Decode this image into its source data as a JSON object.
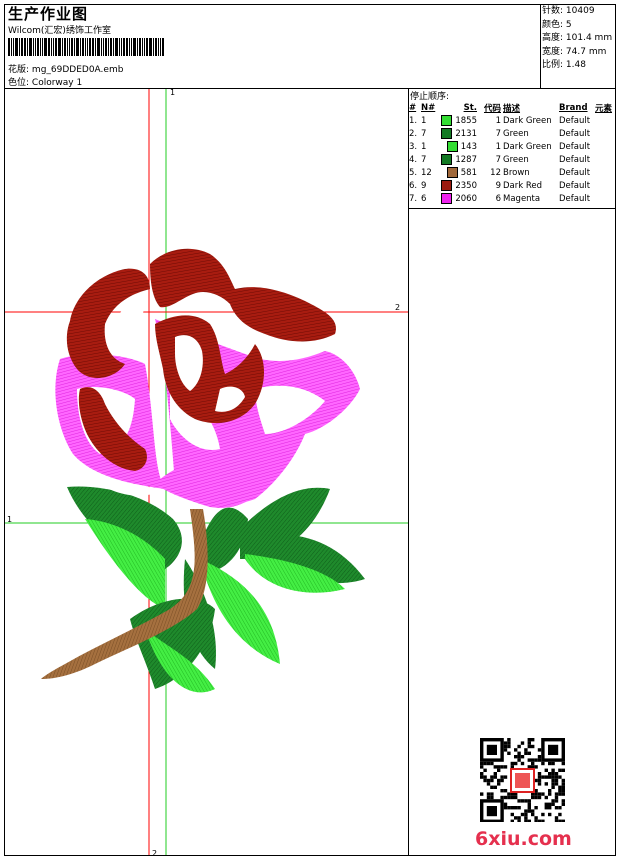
{
  "header": {
    "title": "生产作业图",
    "company": "Wilcom(汇宏)绣饰工作室",
    "design_label": "花版:",
    "design_file": "mg_69DDED0A.emb",
    "colorway_label": "色位:",
    "colorway": "Colorway 1"
  },
  "stats": [
    {
      "label": "针数:",
      "value": "10409"
    },
    {
      "label": "颜色:",
      "value": "5"
    },
    {
      "label": "高度:",
      "value": "101.4 mm"
    },
    {
      "label": "宽度:",
      "value": "74.7 mm"
    },
    {
      "label": "比例:",
      "value": "1.48"
    }
  ],
  "stop_sequence": {
    "label": "停止顺序:",
    "headers": [
      "#",
      "N#",
      "St.",
      "代码",
      "描述",
      "Brand",
      "元素"
    ],
    "rows": [
      {
        "idx": "1.",
        "n": "1",
        "color": "#33dd33",
        "st": "1855",
        "code": "1",
        "desc": "Dark Green",
        "brand": "Default"
      },
      {
        "idx": "2.",
        "n": "7",
        "color": "#137a24",
        "st": "2131",
        "code": "7",
        "desc": "Green",
        "brand": "Default"
      },
      {
        "idx": "3.",
        "n": "1",
        "color": "#33dd33",
        "st": "143",
        "code": "1",
        "desc": "Dark Green",
        "brand": "Default"
      },
      {
        "idx": "4.",
        "n": "7",
        "color": "#137a24",
        "st": "1287",
        "code": "7",
        "desc": "Green",
        "brand": "Default"
      },
      {
        "idx": "5.",
        "n": "12",
        "color": "#a0683a",
        "st": "581",
        "code": "12",
        "desc": "Brown",
        "brand": "Default"
      },
      {
        "idx": "6.",
        "n": "9",
        "color": "#9a1a10",
        "st": "2350",
        "code": "9",
        "desc": "Dark Red",
        "brand": "Default"
      },
      {
        "idx": "7.",
        "n": "6",
        "color": "#ee22ee",
        "st": "2060",
        "code": "6",
        "desc": "Magenta",
        "brand": "Default"
      }
    ]
  },
  "guides": {
    "v1": "1",
    "h2": "2",
    "h1": "1",
    "v2": "2"
  },
  "colors": {
    "guide_red": "#ff0000",
    "guide_green": "#22cc22",
    "logo": "#e5304e"
  },
  "watermark": {
    "main": "6xiu",
    "suffix": ".com"
  }
}
